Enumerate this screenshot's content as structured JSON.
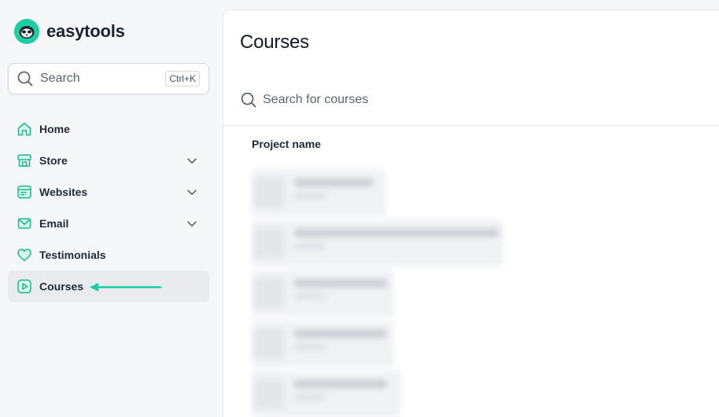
{
  "brand": {
    "name": "easytools",
    "logo_icon": "sloth-logo-icon",
    "accent": "#1ccfa0"
  },
  "search": {
    "label": "Search",
    "shortcut": "Ctrl+K"
  },
  "nav": [
    {
      "label": "Home",
      "icon": "home-icon",
      "has_chevron": false,
      "active": false
    },
    {
      "label": "Store",
      "icon": "store-icon",
      "has_chevron": true,
      "active": false
    },
    {
      "label": "Websites",
      "icon": "website-icon",
      "has_chevron": true,
      "active": false
    },
    {
      "label": "Email",
      "icon": "email-icon",
      "has_chevron": true,
      "active": false
    },
    {
      "label": "Testimonials",
      "icon": "heart-icon",
      "has_chevron": false,
      "active": false
    },
    {
      "label": "Courses",
      "icon": "play-icon",
      "has_chevron": false,
      "active": true
    }
  ],
  "main": {
    "title": "Courses",
    "search_placeholder": "Search for courses",
    "column_header": "Project name",
    "rows_blurred": 5
  },
  "colors": {
    "accent": "#1ccfa0",
    "active_bg": "#e9ebee"
  }
}
